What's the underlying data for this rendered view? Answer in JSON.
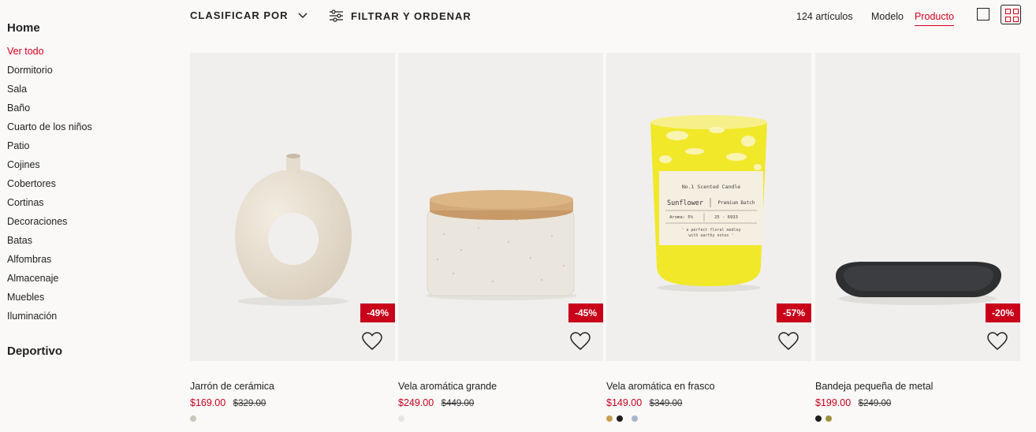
{
  "sidebar": {
    "section1": "Home",
    "items": [
      "Ver todo",
      "Dormitorio",
      "Sala",
      "Baño",
      "Cuarto de los niños",
      "Patio",
      "Cojines",
      "Cobertores",
      "Cortinas",
      "Decoraciones",
      "Batas",
      "Alfombras",
      "Almacenaje",
      "Muebles",
      "Iluminación"
    ],
    "section2": "Deportivo"
  },
  "toolbar": {
    "sort_label": "CLASIFICAR POR",
    "filter_label": "FILTRAR Y ORDENAR",
    "count": "124 artículos",
    "model_label": "Modelo",
    "product_label": "Producto"
  },
  "products": [
    {
      "name": "Jarrón de cerámica",
      "price": "$169.00",
      "old_price": "$329.00",
      "discount": "-49%",
      "swatches": [
        "#c9c8bf"
      ]
    },
    {
      "name": "Vela aromática grande",
      "price": "$249.00",
      "old_price": "$449.00",
      "discount": "-45%",
      "swatches": [
        "#e8e5df"
      ]
    },
    {
      "name": "Vela aromática en frasco",
      "price": "$149.00",
      "old_price": "$349.00",
      "discount": "-57%",
      "swatches": [
        "#c7a050",
        "#1f1f1f",
        "#a9b6cc"
      ]
    },
    {
      "name": "Bandeja pequeña de metal",
      "price": "$199.00",
      "old_price": "$249.00",
      "discount": "-20%",
      "swatches": [
        "#1f1f1f",
        "#a0923c"
      ]
    }
  ],
  "candle_label": {
    "line1": "No.1  Scented Candle",
    "line2": "Sunflower",
    "line3": "Premium Batch",
    "line4": "Aroma: 5%",
    "line5": "25 - 6933",
    "line6": "' a perfect floral medley",
    "line7": "with earthy notes '"
  },
  "colors": {
    "accent": "#d6001c",
    "background": "#faf9f8",
    "image_bg": "#f0efee"
  }
}
